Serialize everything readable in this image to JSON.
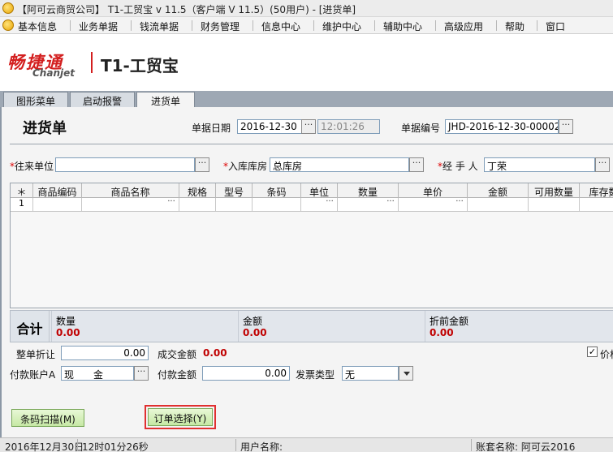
{
  "window": {
    "title": "【阿可云商贸公司】 T1-工贸宝 v 11.5（客户端 V 11.5）(50用户) - [进货单]"
  },
  "menu": [
    "基本信息",
    "业务单据",
    "钱流单据",
    "财务管理",
    "信息中心",
    "维护中心",
    "辅助中心",
    "高级应用",
    "帮助",
    "窗口"
  ],
  "brand": {
    "cn": "畅捷通",
    "en": "Chanjet",
    "product": "T1-工贸宝"
  },
  "tabs": [
    "图形菜单",
    "启动报警",
    "进货单"
  ],
  "form": {
    "title": "进货单",
    "date_label": "单据日期",
    "date_value": "2016-12-30",
    "time_value": "12:01:26",
    "docno_label": "单据编号",
    "docno_value": "JHD-2016-12-30-00002",
    "partner_label": "往来单位",
    "partner_value": "",
    "warehouse_label": "入库库房",
    "warehouse_value": "总库房",
    "handler_label": "经 手 人",
    "handler_value": "丁荣"
  },
  "grid": {
    "columns": [
      "＊",
      "商品编码",
      "商品名称",
      "规格",
      "型号",
      "条码",
      "单位",
      "数量",
      "单价",
      "金额",
      "可用数量",
      "库存数"
    ],
    "rows": [
      [
        "1",
        "",
        "",
        "",
        "",
        "",
        "",
        "",
        "",
        "",
        "",
        ""
      ]
    ]
  },
  "totals": {
    "label": "合计",
    "qty_label": "数量",
    "qty_value": "0.00",
    "amount_label": "金额",
    "amount_value": "0.00",
    "pre_discount_label": "折前金额",
    "pre_discount_value": "0.00"
  },
  "payment": {
    "discount_label": "整单折让",
    "discount_value": "0.00",
    "deal_amount_label": "成交金额",
    "deal_amount_value": "0.00",
    "account_label": "付款账户A",
    "account_value": "现　　金",
    "pay_amount_label": "付款金额",
    "pay_amount_value": "0.00",
    "invoice_label": "发票类型",
    "invoice_value": "无",
    "price_check_label": "价格",
    "price_checked": true
  },
  "buttons": {
    "barcode": "条码扫描(M)",
    "order_select": "订单选择(Y)"
  },
  "status": {
    "date": "2016年12月30日",
    "time": "12时01分26秒",
    "user_label": "用户名称:",
    "account_label": "账套名称: 阿可云2016"
  },
  "colors": {
    "brand_red": "#d31f1f",
    "value_red": "#c00000",
    "highlight_box": "#e03030"
  }
}
